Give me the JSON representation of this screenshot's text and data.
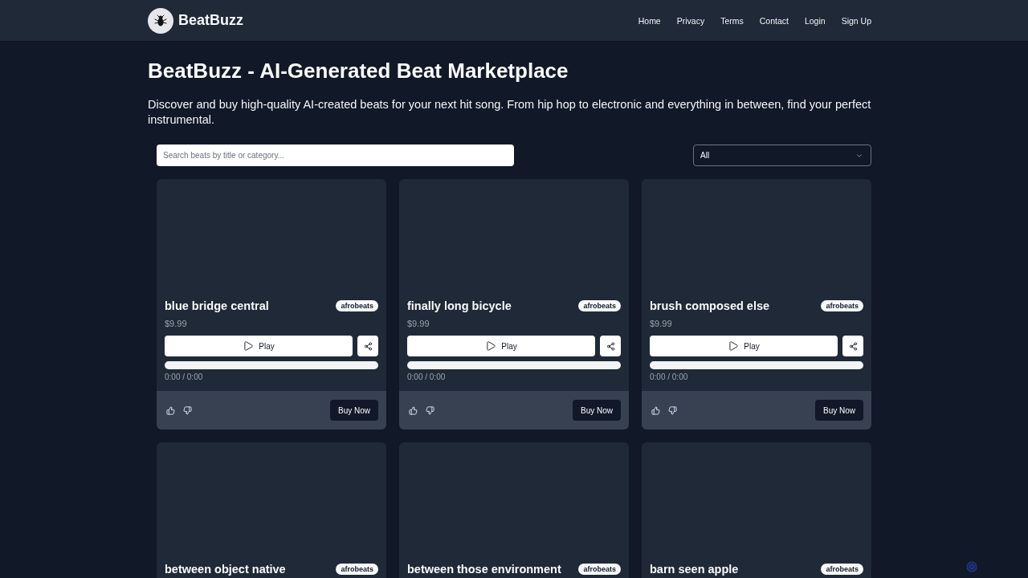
{
  "header": {
    "brand": "BeatBuzz",
    "nav": [
      "Home",
      "Privacy",
      "Terms",
      "Contact",
      "Login",
      "Sign Up"
    ]
  },
  "hero": {
    "title": "BeatBuzz - AI-Generated Beat Marketplace",
    "description": "Discover and buy high-quality AI-created beats for your next hit song. From hip hop to electronic and everything in between, find your perfect instrumental."
  },
  "filters": {
    "search": {
      "placeholder": "Search beats by title or category..."
    },
    "category": {
      "value": "All"
    }
  },
  "beats": [
    {
      "title": "blue bridge central",
      "tag": "afrobeats",
      "price": "$9.99",
      "play_label": "Play",
      "time": "0:00 / 0:00",
      "buy_label": "Buy Now"
    },
    {
      "title": "finally long bicycle",
      "tag": "afrobeats",
      "price": "$9.99",
      "play_label": "Play",
      "time": "0:00 / 0:00",
      "buy_label": "Buy Now"
    },
    {
      "title": "brush composed else",
      "tag": "afrobeats",
      "price": "$9.99",
      "play_label": "Play",
      "time": "0:00 / 0:00",
      "buy_label": "Buy Now"
    },
    {
      "title": "between object native",
      "tag": "afrobeats"
    },
    {
      "title": "between those environment",
      "tag": "afrobeats"
    },
    {
      "title": "barn seen apple",
      "tag": "afrobeats"
    }
  ]
}
